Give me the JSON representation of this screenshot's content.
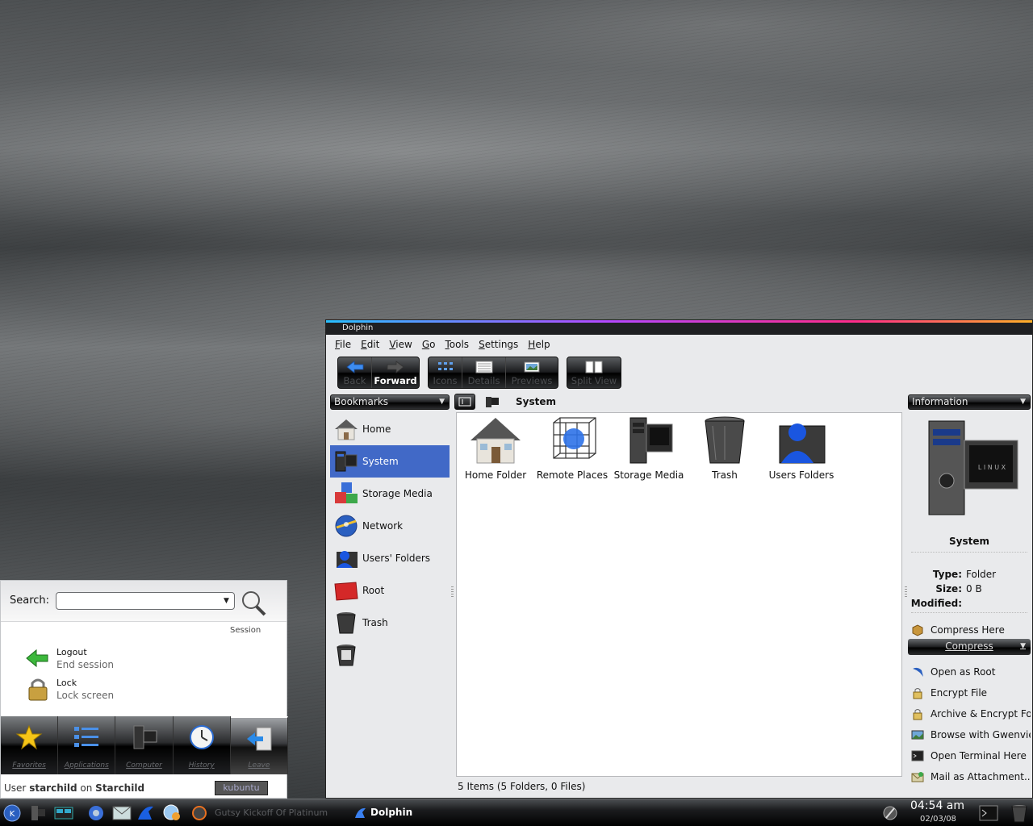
{
  "window": {
    "title": "Dolphin",
    "menu": [
      "File",
      "Edit",
      "View",
      "Go",
      "Tools",
      "Settings",
      "Help"
    ],
    "toolbar": {
      "back": "Back",
      "forward": "Forward",
      "icons": "Icons",
      "details": "Details",
      "previews": "Previews",
      "split_view": "Split View"
    },
    "bookmarks_header": "Bookmarks",
    "bookmarks": [
      {
        "label": "Home",
        "icon": "home-icon"
      },
      {
        "label": "System",
        "icon": "system-icon",
        "selected": true
      },
      {
        "label": "Storage Media",
        "icon": "storage-icon"
      },
      {
        "label": "Network",
        "icon": "network-icon"
      },
      {
        "label": "Users' Folders",
        "icon": "users-icon"
      },
      {
        "label": "Root",
        "icon": "root-icon"
      },
      {
        "label": "Trash",
        "icon": "trash-icon"
      },
      {
        "label": "",
        "icon": "trash-full-icon"
      }
    ],
    "breadcrumb": "System",
    "files": [
      {
        "label": "Home Folder",
        "icon": "home-folder-icon"
      },
      {
        "label": "Remote Places",
        "icon": "remote-places-icon"
      },
      {
        "label": "Storage Media",
        "icon": "storage-media-icon"
      },
      {
        "label": "Trash",
        "icon": "trash-icon"
      },
      {
        "label": "Users Folders",
        "icon": "users-folders-icon"
      }
    ],
    "status": "5 Items (5 Folders, 0 Files)",
    "info": {
      "header": "Information",
      "title": "System",
      "type_key": "Type:",
      "type_value": "Folder",
      "size_key": "Size:",
      "size_value": "0 B",
      "modified_key": "Modified:",
      "modified_value": "",
      "compress_here": "Compress Here",
      "compress_header": "Compress",
      "actions": [
        {
          "label": "Open as Root",
          "icon": "dolphin-icon"
        },
        {
          "label": "Encrypt File",
          "icon": "lock-icon"
        },
        {
          "label": "Archive & Encrypt Fo",
          "icon": "archive-icon"
        },
        {
          "label": "Browse with Gwenvie",
          "icon": "image-viewer-icon"
        },
        {
          "label": "Open Terminal Here",
          "icon": "terminal-icon"
        },
        {
          "label": "Mail as Attachment...",
          "icon": "mail-icon"
        }
      ]
    }
  },
  "kickoff": {
    "search_label": "Search:",
    "search_value": "",
    "session_header": "Session",
    "entries": [
      {
        "title": "Logout",
        "subtitle": "End session",
        "icon": "logout-icon"
      },
      {
        "title": "Lock",
        "subtitle": "Lock screen",
        "icon": "padlock-icon"
      }
    ],
    "tabs": [
      "Favorites",
      "Applications",
      "Computer",
      "History",
      "Leave"
    ],
    "active_tab": "Leave",
    "footer_prefix": "User",
    "footer_user": "starchild",
    "footer_on": "on",
    "footer_host": "Starchild",
    "brand": "kubuntu"
  },
  "taskbar": {
    "tasks": [
      {
        "label": "Gutsy Kickoff Of Platinum",
        "active": false
      },
      {
        "label": "Dolphin",
        "active": true
      }
    ],
    "time": "04:54 am",
    "date": "02/03/08"
  },
  "colors": {
    "selection": "#4169c7",
    "window_bg": "#e9eaec",
    "accent_gradient": [
      "#28c0ff",
      "#b548ff",
      "#ff2c8a",
      "#ffb128"
    ]
  }
}
